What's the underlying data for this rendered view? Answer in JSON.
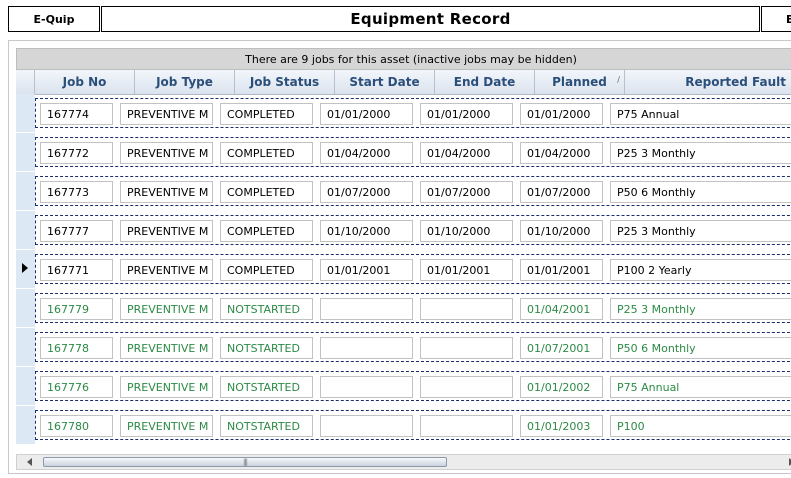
{
  "titlebar": {
    "left_label": "E-Quip",
    "title": "Equipment Record",
    "right_label": "E"
  },
  "grid": {
    "info": "There are 9 jobs for this asset (inactive jobs may be hidden)",
    "columns": [
      "Job No",
      "Job Type",
      "Job Status",
      "Start Date",
      "End Date",
      "Planned",
      "Reported Fault"
    ],
    "sorted_column": "Planned",
    "selected_row_index": 4,
    "rows": [
      {
        "job_no": "167774",
        "job_type": "PREVENTIVE M",
        "status": "COMPLETED",
        "start": "01/01/2000",
        "end": "01/01/2000",
        "planned": "01/01/2000",
        "fault": "P75 Annual",
        "active": true
      },
      {
        "job_no": "167772",
        "job_type": "PREVENTIVE M",
        "status": "COMPLETED",
        "start": "01/04/2000",
        "end": "01/04/2000",
        "planned": "01/04/2000",
        "fault": "P25 3 Monthly",
        "active": true
      },
      {
        "job_no": "167773",
        "job_type": "PREVENTIVE M",
        "status": "COMPLETED",
        "start": "01/07/2000",
        "end": "01/07/2000",
        "planned": "01/07/2000",
        "fault": "P50 6 Monthly",
        "active": true
      },
      {
        "job_no": "167777",
        "job_type": "PREVENTIVE M",
        "status": "COMPLETED",
        "start": "01/10/2000",
        "end": "01/10/2000",
        "planned": "01/10/2000",
        "fault": "P25 3 Monthly",
        "active": true
      },
      {
        "job_no": "167771",
        "job_type": "PREVENTIVE M",
        "status": "COMPLETED",
        "start": "01/01/2001",
        "end": "01/01/2001",
        "planned": "01/01/2001",
        "fault": "P100 2 Yearly",
        "active": true
      },
      {
        "job_no": "167779",
        "job_type": "PREVENTIVE M",
        "status": "NOTSTARTED",
        "start": "",
        "end": "",
        "planned": "01/04/2001",
        "fault": "P25 3 Monthly",
        "active": false
      },
      {
        "job_no": "167778",
        "job_type": "PREVENTIVE M",
        "status": "NOTSTARTED",
        "start": "",
        "end": "",
        "planned": "01/07/2001",
        "fault": "P50 6 Monthly",
        "active": false
      },
      {
        "job_no": "167776",
        "job_type": "PREVENTIVE M",
        "status": "NOTSTARTED",
        "start": "",
        "end": "",
        "planned": "01/01/2002",
        "fault": "P75 Annual",
        "active": false
      },
      {
        "job_no": "167780",
        "job_type": "PREVENTIVE M",
        "status": "NOTSTARTED",
        "start": "",
        "end": "",
        "planned": "01/01/2003",
        "fault": "P100",
        "active": false
      }
    ]
  },
  "colors": {
    "inactive_text": "#2c8a46",
    "header_text": "#2b4f7a",
    "record_border": "#1c2d6b"
  },
  "icons": {
    "sort": "sort-indicator-icon",
    "current_row": "current-row-arrow-icon",
    "scroll_left": "scroll-left-arrow-icon",
    "scroll_right": "scroll-right-arrow-icon"
  }
}
